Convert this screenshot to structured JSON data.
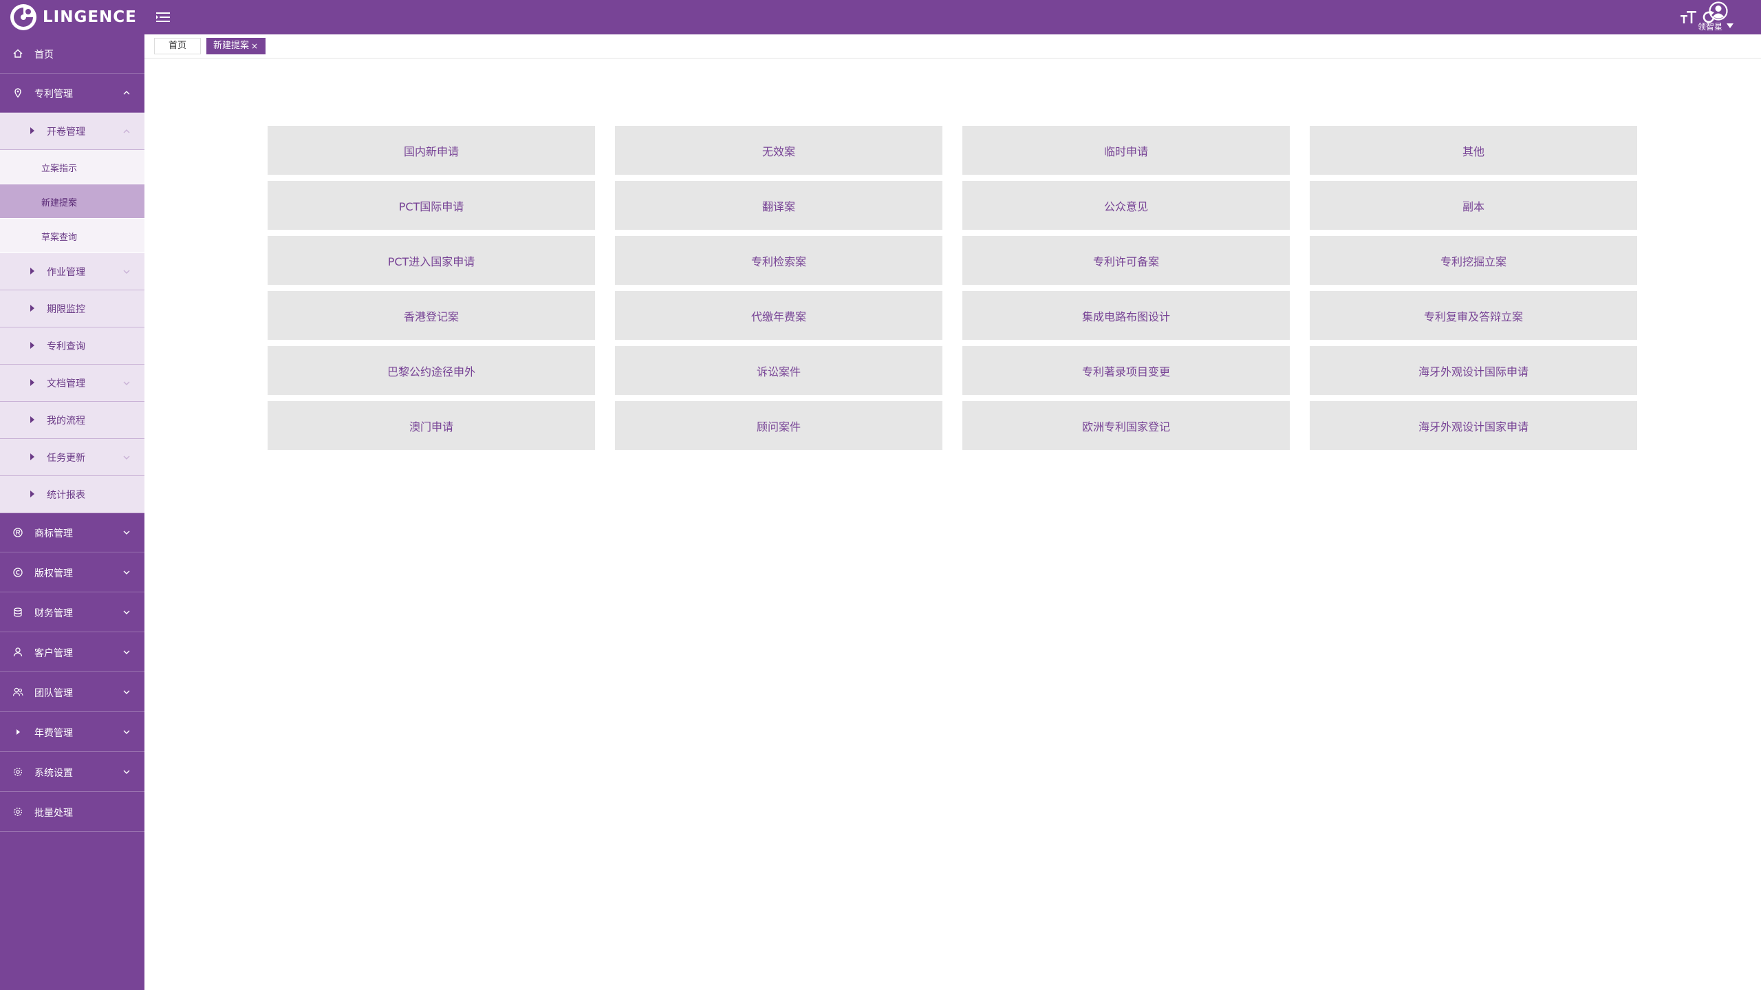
{
  "header": {
    "logo_text": "LINGENCE",
    "user_name": "领智星",
    "icons": [
      "logo-icon",
      "menu-toggle-icon",
      "refresh-icon",
      "font-size-icon",
      "user-icon",
      "caret-down-icon"
    ]
  },
  "sidebar": {
    "home": "首页",
    "patent": "专利管理",
    "patent_sub": {
      "open_case": "开卷管理",
      "open_case_items": [
        "立案指示",
        "新建提案",
        "草案查询"
      ],
      "work": "作业管理",
      "deadline": "期限监控",
      "query": "专利查询",
      "docs": "文档管理",
      "flow": "我的流程",
      "task": "任务更新",
      "stats": "统计报表"
    },
    "trademark": "商标管理",
    "copyright": "版权管理",
    "finance": "财务管理",
    "customer": "客户管理",
    "team": "团队管理",
    "annual": "年费管理",
    "settings": "系统设置",
    "batch": "批量处理"
  },
  "tabs": {
    "home": "首页",
    "current": "新建提案",
    "close": "×"
  },
  "case_types": [
    "国内新申请",
    "无效案",
    "临时申请",
    "其他",
    "PCT国际申请",
    "翻译案",
    "公众意见",
    "副本",
    "PCT进入国家申请",
    "专利检索案",
    "专利许可备案",
    "专利挖掘立案",
    "香港登记案",
    "代缴年费案",
    "集成电路布图设计",
    "专利复审及答辩立案",
    "巴黎公约途径申外",
    "诉讼案件",
    "专利著录项目变更",
    "海牙外观设计国际申请",
    "澳门申请",
    "顾问案件",
    "欧洲专利国家登记",
    "海牙外观设计国家申请"
  ],
  "colors": {
    "brand": "#784496",
    "card_bg": "#e6e6e6",
    "active_item": "#c3a8d2"
  }
}
